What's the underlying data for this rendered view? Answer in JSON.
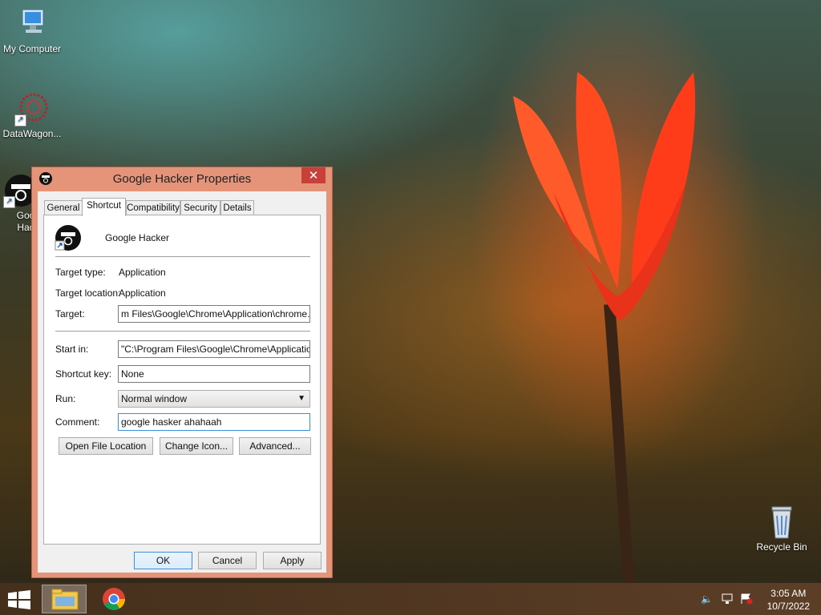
{
  "desktop": {
    "icons": [
      {
        "label": "My Computer"
      },
      {
        "label": "DataWagon..."
      },
      {
        "label": "Goo Hac"
      },
      {
        "label": "Recycle Bin"
      }
    ]
  },
  "dialog": {
    "title": "Google Hacker Properties",
    "close_label": "✕",
    "tabs": [
      "General",
      "Shortcut",
      "Compatibility",
      "Security",
      "Details"
    ],
    "active_tab": "Shortcut",
    "app_name": "Google Hacker",
    "target_type_label": "Target type:",
    "target_type_value": "Application",
    "target_location_label": "Target location:",
    "target_location_value": "Application",
    "target_label": "Target:",
    "target_value": "m Files\\Google\\Chrome\\Application\\chrome.exe\"",
    "start_in_label": "Start in:",
    "start_in_value": "\"C:\\Program Files\\Google\\Chrome\\Application\"",
    "shortcut_key_label": "Shortcut key:",
    "shortcut_key_value": "None",
    "run_label": "Run:",
    "run_value": "Normal window",
    "comment_label": "Comment:",
    "comment_value": "google hasker ahahaah",
    "buttons": {
      "open_file_location": "Open File Location",
      "change_icon": "Change Icon...",
      "advanced": "Advanced...",
      "ok": "OK",
      "cancel": "Cancel",
      "apply": "Apply"
    }
  },
  "taskbar": {
    "clock_time": "3:05 AM",
    "clock_date": "10/7/2022"
  },
  "colors": {
    "title_bar": "#e5947a",
    "close_button": "#c7403a",
    "focus_border": "#3a8fd8"
  }
}
